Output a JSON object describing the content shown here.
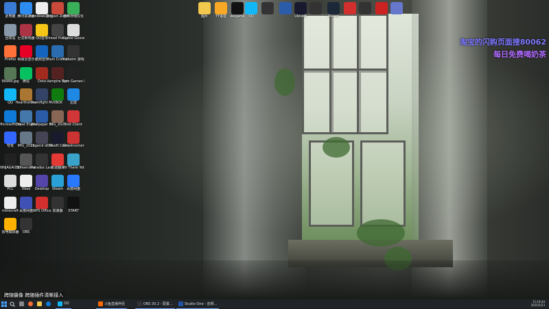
{
  "desktop": {
    "left_icons": [
      {
        "label": "此电脑",
        "color": "#3a7bd5"
      },
      {
        "label": "腾讯加速器",
        "color": "#2d8cf0"
      },
      {
        "label": "windows激活工具",
        "color": "#eeeeee"
      },
      {
        "label": "Project Zomboid",
        "color": "#c94a3a"
      },
      {
        "label": "猫咪存储优化",
        "color": "#3aaf5a"
      },
      {
        "label": "回收站",
        "color": "#8899aa"
      },
      {
        "label": "巨龙斩线器",
        "color": "#aa3344"
      },
      {
        "label": "QQ音乐",
        "color": "#f5c518"
      },
      {
        "label": "Dread Hunger",
        "color": "#444444"
      },
      {
        "label": "Goose Goose Duck",
        "color": "#dddddd"
      },
      {
        "label": "Firefox",
        "color": "#ff7139"
      },
      {
        "label": "网易云音乐",
        "color": "#e60026"
      },
      {
        "label": "酷狗音乐",
        "color": "#1565c0"
      },
      {
        "label": "Plain Craft Launcher",
        "color": "#2b6cb0"
      },
      {
        "label": "Valheim 游戏",
        "color": "#333333"
      },
      {
        "label": "99999.jpg",
        "color": "#557755"
      },
      {
        "label": "微信",
        "color": "#07c160"
      },
      {
        "label": "Dota",
        "color": "#a12b1f"
      },
      {
        "label": "Vampire Survivors",
        "color": "#552222"
      },
      {
        "label": "Epic Games Launcher",
        "color": "#222222"
      },
      {
        "label": "QQ",
        "color": "#12b7f5"
      },
      {
        "label": "Hearthstone",
        "color": "#aa7733"
      },
      {
        "label": "Teamfight Manager",
        "color": "#334466"
      },
      {
        "label": "XBOX",
        "color": "#107c10"
      },
      {
        "label": "迅雷",
        "color": "#1e88e5"
      },
      {
        "label": "Microsoft Edge",
        "color": "#0f7ad8"
      },
      {
        "label": "Cheat Engine",
        "color": "#4477aa"
      },
      {
        "label": "Wallpaper Engine",
        "color": "#2a5caa"
      },
      {
        "label": "IMG_2025",
        "color": "#886655"
      },
      {
        "label": "Riot Client",
        "color": "#d13639"
      },
      {
        "label": "夸克",
        "color": "#3366ff"
      },
      {
        "label": "IMG_2025",
        "color": "#667788"
      },
      {
        "label": "Legend of YMIR",
        "color": "#444455"
      },
      {
        "label": "Ubisoft Connect",
        "color": "#1a1a2e"
      },
      {
        "label": "Ghostrunner",
        "color": "#cc3333"
      },
      {
        "label": "NINJAGAIDEN",
        "color": "#222222"
      },
      {
        "label": "Screenshot",
        "color": "#555555"
      },
      {
        "label": "Paradox Launcher v2",
        "color": "#333333"
      },
      {
        "label": "有道翻译",
        "color": "#e53935"
      },
      {
        "label": "RV There Yet",
        "color": "#3aa3c9"
      },
      {
        "label": "PCL",
        "color": "#dddddd"
      },
      {
        "label": "Xbox",
        "color": "#eeeeee"
      },
      {
        "label": "Desktop",
        "color": "#5544aa"
      },
      {
        "label": "Steam",
        "color": "#2aa1d6"
      },
      {
        "label": "百度网盘",
        "color": "#2979ff"
      },
      {
        "label": "minecraft",
        "color": "#eeeeee"
      },
      {
        "label": "百度网盘",
        "color": "#3f51b5"
      },
      {
        "label": "WPS Office",
        "color": "#d32f2f"
      },
      {
        "label": "加速器",
        "color": "#333333"
      },
      {
        "label": "START",
        "color": "#111111"
      },
      {
        "label": "雷电模拟器",
        "color": "#ffb300"
      },
      {
        "label": "OBS",
        "color": "#333333"
      }
    ],
    "top_icons": [
      {
        "label": "图片",
        "color": "#f2c94c"
      },
      {
        "label": "YY语音",
        "color": "#f9a825"
      },
      {
        "label": "wegame",
        "color": "#111111"
      },
      {
        "label": "QQ",
        "color": "#12b7f5"
      },
      {
        "label": "",
        "color": "#333333"
      },
      {
        "label": "",
        "color": "#2a5caa"
      },
      {
        "label": "Ubisoft",
        "color": "#1a1a2e"
      },
      {
        "label": "",
        "color": "#333333"
      },
      {
        "label": "Steam",
        "color": "#1b2838"
      },
      {
        "label": "",
        "color": "#d32f2f"
      },
      {
        "label": "",
        "color": "#333333"
      },
      {
        "label": "",
        "color": "#cc2222"
      },
      {
        "label": "",
        "color": "#6677cc"
      }
    ]
  },
  "promo": {
    "line1": "淘宝的闪购页面搜80062",
    "line2": "每日免费喝奶茶"
  },
  "camera_caption": "跨随摄像 跨随插件清晰接入",
  "taskbar": {
    "tasks": [
      {
        "label": "QQ",
        "color": "#12b7f5"
      },
      {
        "label": "斗鱼直播伴侣",
        "color": "#ff6a00"
      },
      {
        "label": "OBS 30.2 - 配置...",
        "color": "#333333"
      },
      {
        "label": "Studio One - 音频...",
        "color": "#2255aa"
      }
    ],
    "time": "11:19:44",
    "date": "2025/5/23"
  }
}
